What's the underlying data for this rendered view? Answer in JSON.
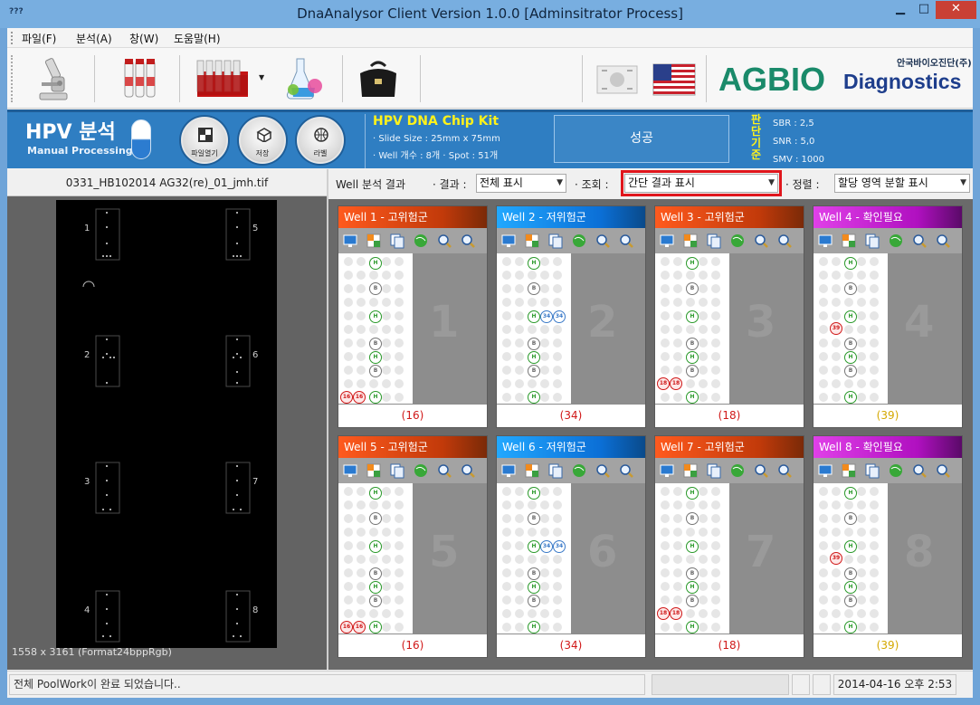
{
  "window": {
    "title": "DnaAnalysor Client Version 1.0.0 [Adminsitrator Process]",
    "icon_text": "???"
  },
  "menu": [
    "파일(F)",
    "분석(A)",
    "창(W)",
    "도움말(H)"
  ],
  "toolbar": {
    "buttons": [
      "microscope-icon",
      "sample-tubes-icon",
      "tube-rack-icon",
      "flasks-icon",
      "doctor-bag-icon",
      "korea-flag-icon",
      "usa-flag-icon"
    ],
    "brand_sub": "안국바이오진단(주)",
    "brand_ag": "AGBIO",
    "brand_diag": "Diagnostics"
  },
  "banner": {
    "title": "HPV 분석",
    "subtitle": "Manual Processing",
    "round_buttons": [
      "파일열기",
      "저장",
      "라벨"
    ],
    "kit_title": "HPV DNA Chip Kit",
    "kit_slide": "· Slide Size : 25mm x 75mm",
    "kit_well": "· Well 개수 : 8개 · Spot : 51개",
    "result": "성공",
    "criteria_label": "판단기준",
    "sbr": "SBR : 2,5",
    "snr": "SNR : 5,0",
    "smv": "SMV : 1000"
  },
  "image_panel": {
    "file_name": "0331_HB102014 AG32(re)_01_jmh.tif",
    "dims": "1558 x 3161 (Format24bppRgb)",
    "well_labels": [
      "1",
      "2",
      "3",
      "4",
      "5",
      "6",
      "7",
      "8"
    ]
  },
  "filters": {
    "section": "Well 분석 결과",
    "result_label": "· 결과 :",
    "result_value": "전체 표시",
    "view_label": "· 조회 :",
    "view_value": "간단 결과 표시",
    "sort_label": "· 정렬 :",
    "sort_value": "할당 영역 분할 표시"
  },
  "wells": [
    {
      "title": "Well 1 - 고위험군",
      "kind": "high",
      "num": "1",
      "result": "(16)",
      "result_color": "#d01818"
    },
    {
      "title": "Well 2 - 저위험군",
      "kind": "low",
      "num": "2",
      "result": "(34)",
      "result_color": "#d01818"
    },
    {
      "title": "Well 3 - 고위험군",
      "kind": "high",
      "num": "3",
      "result": "(18)",
      "result_color": "#d01818"
    },
    {
      "title": "Well 4 - 확인필요",
      "kind": "check",
      "num": "4",
      "result": "(39)",
      "result_color": "#d4a800"
    },
    {
      "title": "Well 5 - 고위험군",
      "kind": "high",
      "num": "5",
      "result": "(16)",
      "result_color": "#d01818"
    },
    {
      "title": "Well 6 - 저위험군",
      "kind": "low",
      "num": "6",
      "result": "(34)",
      "result_color": "#d01818"
    },
    {
      "title": "Well 7 - 고위험군",
      "kind": "high",
      "num": "7",
      "result": "(18)",
      "result_color": "#d01818"
    },
    {
      "title": "Well 8 - 확인필요",
      "kind": "check",
      "num": "8",
      "result": "(39)",
      "result_color": "#d4a800"
    }
  ],
  "well_markers": {
    "common": [
      "H",
      "B",
      "H",
      "B",
      "H",
      "B",
      "H"
    ],
    "type16": [
      "16",
      "16"
    ],
    "type34": [
      "34",
      "34"
    ],
    "type18": [
      "18",
      "18"
    ],
    "type39": [
      "39"
    ]
  },
  "well_tool_icons": [
    "monitor-icon",
    "grid-table-icon",
    "copy-docs-icon",
    "globe-icon",
    "zoom-in-icon",
    "zoom-out-icon"
  ],
  "status": {
    "message": "전체 PoolWork이 완료 되었습니다..",
    "datetime": "2014-04-16 오후 2:53"
  }
}
